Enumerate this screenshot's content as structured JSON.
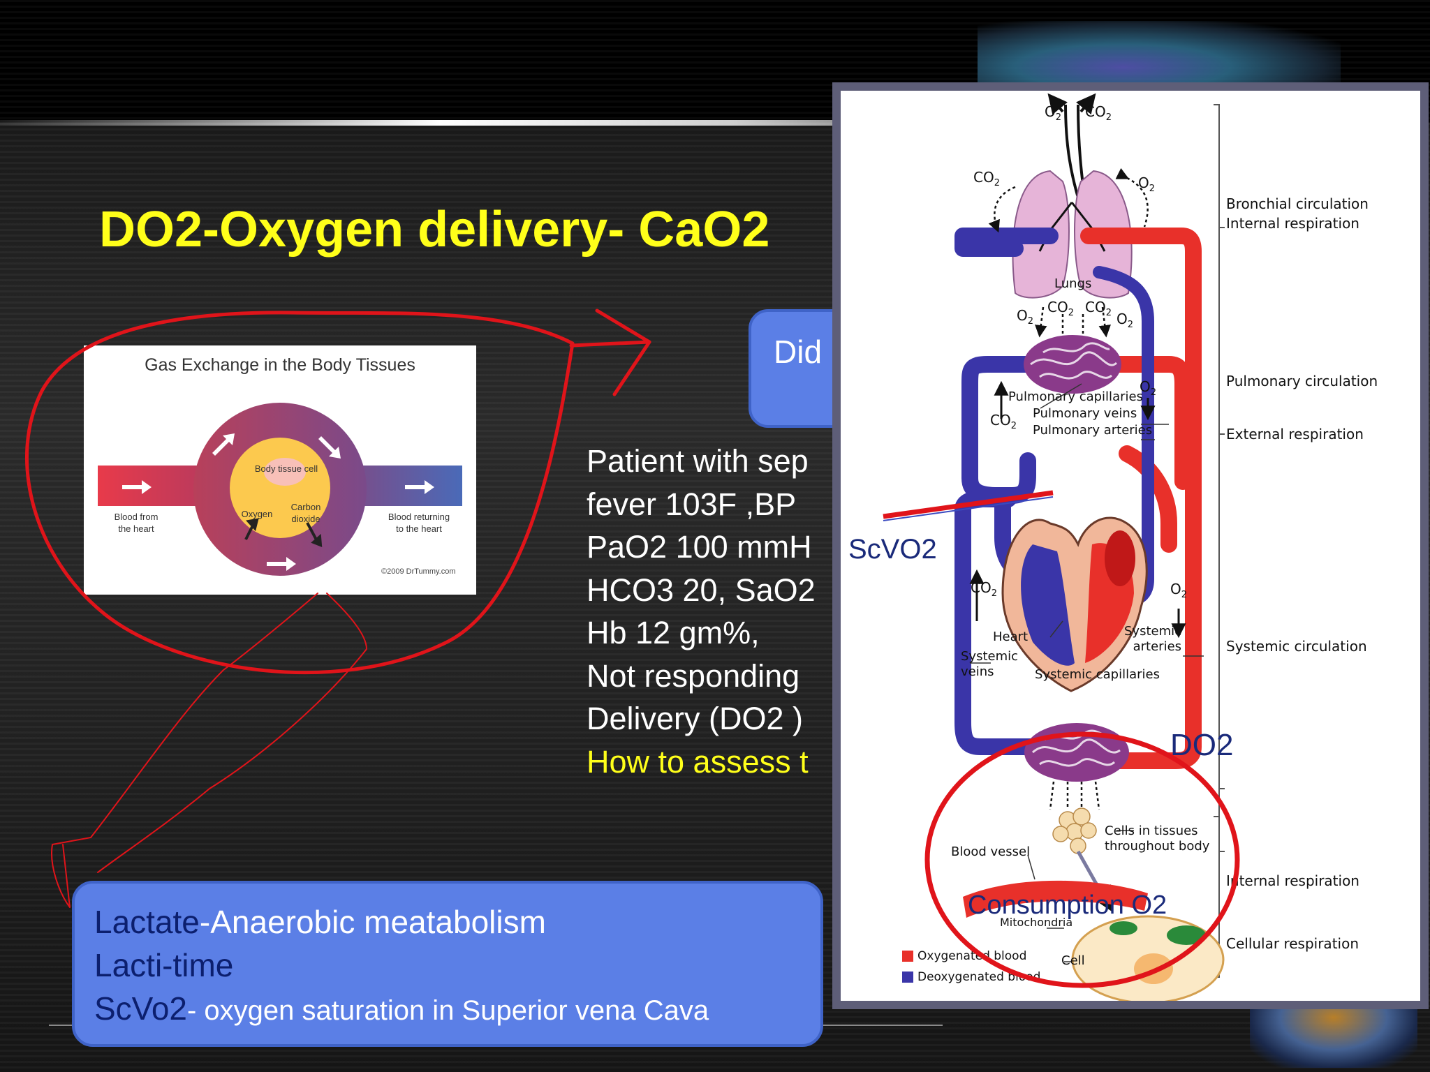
{
  "slide": {
    "title": "DO2-Oxygen delivery- CaO2",
    "question_box_text": "Did",
    "case_lines": [
      "Patient with sep",
      "fever 103F ,BP",
      "PaO2 100 mmH",
      "HCO3 20, SaO2",
      "Hb 12 gm%,",
      "Not responding",
      "Delivery (DO2 )"
    ],
    "case_highlight": "How to assess t",
    "answers": {
      "lactate_key": "Lactate",
      "lactate_rest": "-Anaerobic meatabolism",
      "lactitime": "Lacti-time",
      "scvo2_key": "ScVo2",
      "scvo2_rest": "- oxygen saturation in Superior vena Cava"
    }
  },
  "gas_exchange_figure": {
    "title": "Gas Exchange in the Body Tissues",
    "cell_label": "Body tissue cell",
    "oxygen_label": "Oxygen",
    "co2_label_line1": "Carbon",
    "co2_label_line2": "dioxide",
    "from_heart_line1": "Blood from",
    "from_heart_line2": "the heart",
    "returning_line1": "Blood returning",
    "returning_line2": "to the heart",
    "credit": "©2009 DrTummy.com"
  },
  "circulation_figure": {
    "gas_top_o2": "O2",
    "gas_top_co2": "CO2",
    "lungs": "Lungs",
    "pulmonary_capillaries": "Pulmonary capillaries",
    "pulmonary_veins": "Pulmonary veins",
    "pulmonary_arteries": "Pulmonary arteries",
    "heart": "Heart",
    "systemic_veins_line1": "Systemic",
    "systemic_veins_line2": "veins",
    "systemic_arteries_line1": "Systemic",
    "systemic_arteries_line2": "arteries",
    "systemic_capillaries": "Systemic capillaries",
    "cells_line1": "Cells in tissues",
    "cells_line2": "throughout body",
    "blood_vessel": "Blood vessel",
    "mitochondria": "Mitochondria",
    "cell": "Cell",
    "legend_oxygenated": "Oxygenated blood",
    "legend_deoxygenated": "Deoxygenated blood",
    "right_labels": {
      "bronchial": "Bronchial circulation",
      "internal_top": "Internal respiration",
      "pulmonary": "Pulmonary circulation",
      "external": "External respiration",
      "systemic": "Systemic circulation",
      "internal_bottom": "Internal respiration",
      "cellular": "Cellular respiration"
    },
    "colors": {
      "oxygenated": "#e8302a",
      "deoxygenated": "#3a35a8"
    }
  },
  "annotations": {
    "scvo2": "ScVO2",
    "do2": "DO2",
    "consumption": "Consumption O2",
    "ink_color": "#e0141a"
  }
}
